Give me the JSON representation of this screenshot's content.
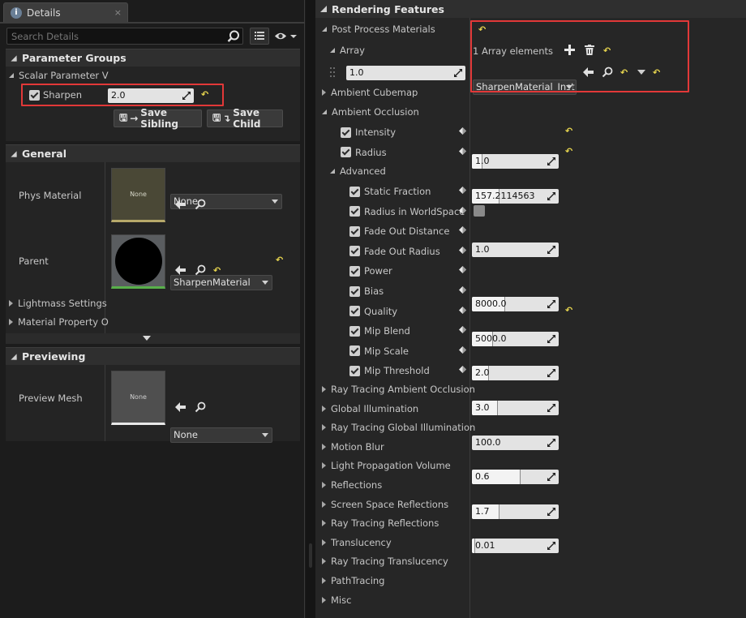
{
  "left": {
    "tab_title": "Details",
    "tab_close": "×",
    "search_placeholder": "Search Details",
    "parameter_groups": {
      "header": "Parameter Groups",
      "group": "Scalar Parameter V",
      "sharpen_label": "Sharpen",
      "sharpen_value": "2.0",
      "save_sibling": "Save Sibling",
      "save_child": "Save Child"
    },
    "general": {
      "header": "General",
      "phys_material_label": "Phys Material",
      "phys_material_thumb": "None",
      "phys_material_value": "None",
      "parent_label": "Parent",
      "parent_value": "SharpenMaterial",
      "lightmass": "Lightmass Settings",
      "material_property": "Material Property O"
    },
    "previewing": {
      "header": "Previewing",
      "preview_mesh_label": "Preview Mesh",
      "preview_thumb": "None",
      "preview_value": "None"
    }
  },
  "right": {
    "header": "Rendering Features",
    "post_process": "Post Process Materials",
    "array_label": "Array",
    "array_count": "1 Array elements",
    "array_weight": "1.0",
    "array_material": "SharpenMaterial_Inst",
    "ambient_cubemap": "Ambient Cubemap",
    "ambient_occlusion": "Ambient Occlusion",
    "ao_rows": [
      {
        "label": "Intensity",
        "value": "1.0",
        "fill": 0.12,
        "reset": true
      },
      {
        "label": "Radius",
        "value": "157.2114563",
        "fill": 0.32,
        "reset": true
      }
    ],
    "advanced": "Advanced",
    "adv_rows": [
      {
        "label": "Static Fraction",
        "value": "1.0",
        "fill": 0.0,
        "reset": false,
        "type": "num"
      },
      {
        "label": "Radius in WorldSpace",
        "value": "",
        "fill": 0,
        "reset": false,
        "type": "check"
      },
      {
        "label": "Fade Out Distance",
        "value": "8000.0",
        "fill": 0.38,
        "reset": false,
        "type": "num"
      },
      {
        "label": "Fade Out Radius",
        "value": "5000.0",
        "fill": 0.24,
        "reset": false,
        "type": "num"
      },
      {
        "label": "Power",
        "value": "2.0",
        "fill": 0.2,
        "reset": false,
        "type": "num"
      },
      {
        "label": "Bias",
        "value": "3.0",
        "fill": 0.3,
        "reset": false,
        "type": "num"
      },
      {
        "label": "Quality",
        "value": "100.0",
        "fill": 0.0,
        "reset": true,
        "type": "num"
      },
      {
        "label": "Mip Blend",
        "value": "0.6",
        "fill": 0.56,
        "reset": false,
        "type": "num"
      },
      {
        "label": "Mip Scale",
        "value": "1.7",
        "fill": 0.32,
        "reset": false,
        "type": "num"
      },
      {
        "label": "Mip Threshold",
        "value": "0.01",
        "fill": 0.04,
        "reset": false,
        "type": "num"
      }
    ],
    "collapsed": [
      "Ray Tracing Ambient Occlusion",
      "Global Illumination",
      "Ray Tracing Global Illumination",
      "Motion Blur",
      "Light Propagation Volume",
      "Reflections",
      "Screen Space Reflections",
      "Ray Tracing Reflections",
      "Translucency",
      "Ray Tracing Translucency",
      "PathTracing",
      "Misc"
    ]
  },
  "colors": {
    "highlight_box": "#e23838",
    "reset_arrow": "#e7d54f"
  }
}
